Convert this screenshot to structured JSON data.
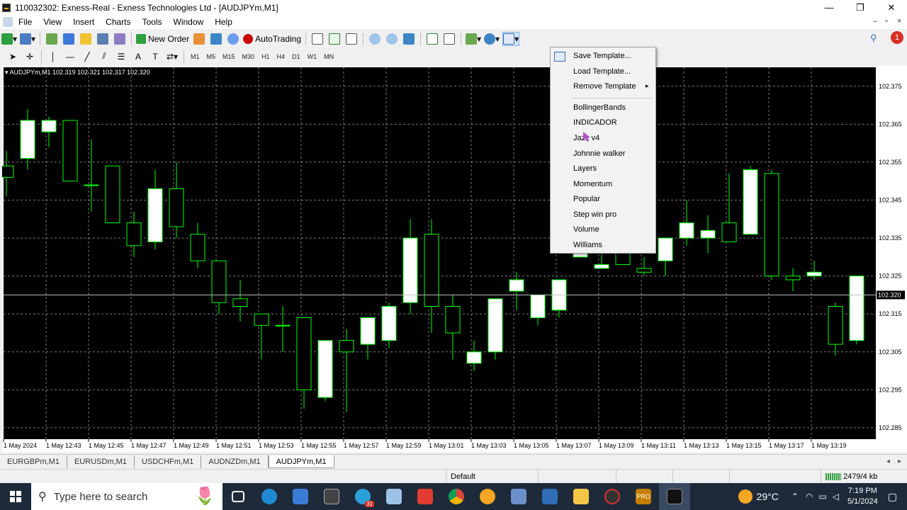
{
  "window": {
    "title": "110032302: Exness-Real - Exness Technologies Ltd - [AUDJPYm,M1]",
    "controls": [
      "—",
      "❐",
      "✕"
    ]
  },
  "menu": [
    "File",
    "View",
    "Insert",
    "Charts",
    "Tools",
    "Window",
    "Help"
  ],
  "toolbar": {
    "new_order": "New Order",
    "autotrading": "AutoTrading"
  },
  "timeframes": [
    "M1",
    "M5",
    "M15",
    "M30",
    "H1",
    "H4",
    "D1",
    "W1",
    "MN"
  ],
  "chart": {
    "info": "AUDJPYm,M1  102.319 102.321 102.317 102.320",
    "current_price_label": "102.320"
  },
  "chart_data": {
    "type": "candlestick",
    "symbol": "AUDJPYm",
    "timeframe": "M1",
    "ohlc": {
      "open": 102.319,
      "high": 102.321,
      "low": 102.317,
      "close": 102.32
    },
    "y_ticks": [
      "102.375",
      "102.365",
      "102.355",
      "102.345",
      "102.335",
      "102.325",
      "102.315",
      "102.305",
      "102.295",
      "102.285"
    ],
    "ylim": [
      102.282,
      102.38
    ],
    "x_ticks": [
      "1 May 2024",
      "1 May 12:43",
      "1 May 12:45",
      "1 May 12:47",
      "1 May 12:49",
      "1 May 12:51",
      "1 May 12:53",
      "1 May 12:55",
      "1 May 12:57",
      "1 May 12:59",
      "1 May 13:01",
      "1 May 13:03",
      "1 May 13:05",
      "1 May 13:07",
      "1 May 13:09",
      "1 May 13:11",
      "1 May 13:13",
      "1 May 13:15",
      "1 May 13:17",
      "1 May 13:19"
    ],
    "candles": [
      {
        "o": 102.354,
        "h": 102.358,
        "l": 102.346,
        "c": 102.351
      },
      {
        "o": 102.356,
        "h": 102.369,
        "l": 102.353,
        "c": 102.366
      },
      {
        "o": 102.363,
        "h": 102.367,
        "l": 102.359,
        "c": 102.366
      },
      {
        "o": 102.366,
        "h": 102.366,
        "l": 102.35,
        "c": 102.35
      },
      {
        "o": 102.349,
        "h": 102.361,
        "l": 102.342,
        "c": 102.349
      },
      {
        "o": 102.354,
        "h": 102.354,
        "l": 102.34,
        "c": 102.339
      },
      {
        "o": 102.339,
        "h": 102.342,
        "l": 102.33,
        "c": 102.333
      },
      {
        "o": 102.334,
        "h": 102.353,
        "l": 102.332,
        "c": 102.348
      },
      {
        "o": 102.348,
        "h": 102.355,
        "l": 102.335,
        "c": 102.338
      },
      {
        "o": 102.336,
        "h": 102.339,
        "l": 102.327,
        "c": 102.329
      },
      {
        "o": 102.329,
        "h": 102.329,
        "l": 102.315,
        "c": 102.318
      },
      {
        "o": 102.319,
        "h": 102.324,
        "l": 102.313,
        "c": 102.317
      },
      {
        "o": 102.315,
        "h": 102.315,
        "l": 102.303,
        "c": 102.312
      },
      {
        "o": 102.312,
        "h": 102.317,
        "l": 102.305,
        "c": 102.312
      },
      {
        "o": 102.314,
        "h": 102.314,
        "l": 102.29,
        "c": 102.295
      },
      {
        "o": 102.293,
        "h": 102.308,
        "l": 102.292,
        "c": 102.308
      },
      {
        "o": 102.308,
        "h": 102.311,
        "l": 102.289,
        "c": 102.305
      },
      {
        "o": 102.307,
        "h": 102.314,
        "l": 102.303,
        "c": 102.314
      },
      {
        "o": 102.308,
        "h": 102.318,
        "l": 102.306,
        "c": 102.317
      },
      {
        "o": 102.318,
        "h": 102.34,
        "l": 102.315,
        "c": 102.335
      },
      {
        "o": 102.336,
        "h": 102.34,
        "l": 102.31,
        "c": 102.317
      },
      {
        "o": 102.317,
        "h": 102.32,
        "l": 102.303,
        "c": 102.31
      },
      {
        "o": 102.302,
        "h": 102.308,
        "l": 102.3,
        "c": 102.305
      },
      {
        "o": 102.305,
        "h": 102.319,
        "l": 102.303,
        "c": 102.319
      },
      {
        "o": 102.321,
        "h": 102.326,
        "l": 102.316,
        "c": 102.324
      },
      {
        "o": 102.314,
        "h": 102.32,
        "l": 102.312,
        "c": 102.32
      },
      {
        "o": 102.316,
        "h": 102.324,
        "l": 102.314,
        "c": 102.324
      },
      {
        "o": 102.33,
        "h": 102.332,
        "l": 102.33,
        "c": 102.331
      },
      {
        "o": 102.327,
        "h": 102.332,
        "l": 102.327,
        "c": 102.328
      },
      {
        "o": 102.333,
        "h": 102.335,
        "l": 102.328,
        "c": 102.328
      },
      {
        "o": 102.327,
        "h": 102.33,
        "l": 102.325,
        "c": 102.326
      },
      {
        "o": 102.329,
        "h": 102.335,
        "l": 102.325,
        "c": 102.335
      },
      {
        "o": 102.335,
        "h": 102.345,
        "l": 102.333,
        "c": 102.339
      },
      {
        "o": 102.335,
        "h": 102.341,
        "l": 102.331,
        "c": 102.337
      },
      {
        "o": 102.339,
        "h": 102.352,
        "l": 102.337,
        "c": 102.334
      },
      {
        "o": 102.336,
        "h": 102.354,
        "l": 102.336,
        "c": 102.353
      },
      {
        "o": 102.352,
        "h": 102.353,
        "l": 102.324,
        "c": 102.325
      },
      {
        "o": 102.325,
        "h": 102.327,
        "l": 102.321,
        "c": 102.324
      },
      {
        "o": 102.325,
        "h": 102.329,
        "l": 102.324,
        "c": 102.326
      },
      {
        "o": 102.317,
        "h": 102.318,
        "l": 102.304,
        "c": 102.307
      },
      {
        "o": 102.308,
        "h": 102.325,
        "l": 102.307,
        "c": 102.325
      },
      {
        "o": 102.32,
        "h": 102.322,
        "l": 102.318,
        "c": 102.32
      }
    ]
  },
  "context_menu": {
    "items": [
      "Save Template...",
      "Load Template...",
      "Remove Template"
    ],
    "submenu_arrow": "▸",
    "templates": [
      "BollingerBands",
      "INDICADOR",
      "Jazz v4",
      "Johnnie walker",
      "Layers",
      "Momentum",
      "Popular",
      "Step win pro",
      "Volume",
      "Williams"
    ]
  },
  "tabs": [
    "EURGBPm,M1",
    "EURUSDm,M1",
    "USDCHFm,M1",
    "AUDNZDm,M1",
    "AUDJPYm,M1"
  ],
  "active_tab": "AUDJPYm,M1",
  "status": {
    "profile": "Default",
    "traffic": "2479/4 kb"
  },
  "taskbar": {
    "search_placeholder": "Type here to search",
    "weather": "29°C",
    "time": "7:19 PM",
    "date": "5/1/2024",
    "badge": "31"
  },
  "colors": {
    "chart_bg": "#000000",
    "candle_bull": "#ffffff",
    "candle_outline": "#00ff00",
    "grid": "#7a7a7a",
    "taskbar_bg": "#1e2a3a"
  }
}
